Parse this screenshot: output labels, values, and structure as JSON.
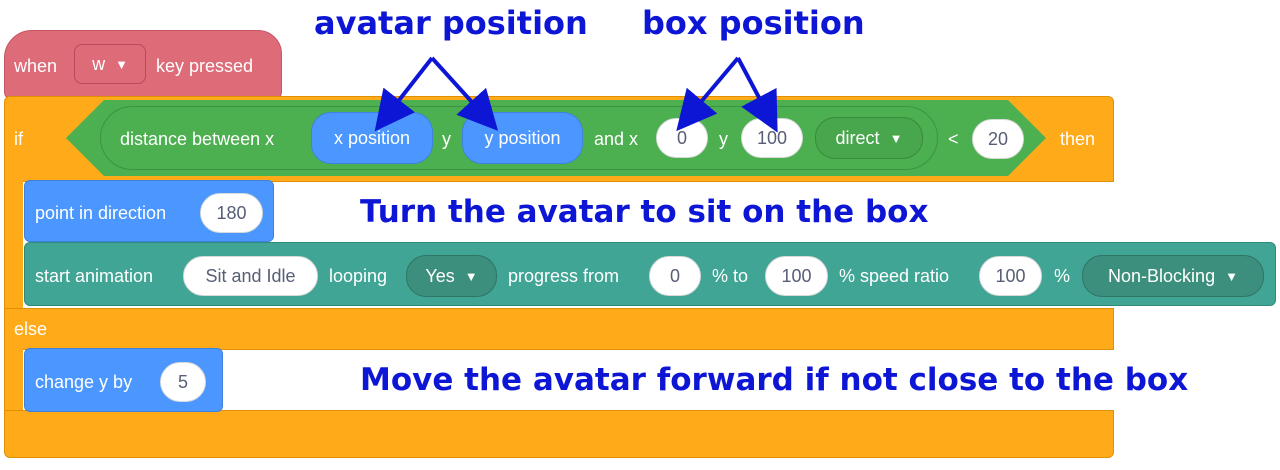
{
  "event_block": {
    "prefix": "when",
    "key_value": "w",
    "suffix": "key pressed"
  },
  "if_block": {
    "if_label": "if",
    "then_label": "then",
    "else_label": "else"
  },
  "condition": {
    "distance_label": "distance between x",
    "x_reporter": "x position",
    "y_label": "y",
    "y_reporter": "y position",
    "and_x_label": "and x",
    "x_value": "0",
    "y_label_2": "y",
    "y_value": "100",
    "mode_value": "direct",
    "operator": "<",
    "threshold_value": "20"
  },
  "point_block": {
    "label": "point in direction",
    "value": "180"
  },
  "animation_block": {
    "label": "start animation",
    "animation_value": "Sit and Idle",
    "looping_label": "looping",
    "looping_value": "Yes",
    "progress_label": "progress from",
    "progress_from": "0",
    "to_label": "% to",
    "progress_to": "100",
    "speed_label": "% speed ratio",
    "speed_value": "100",
    "percent_label": "%",
    "blocking_value": "Non-Blocking"
  },
  "change_block": {
    "label": "change y by",
    "value": "5"
  },
  "annotations": {
    "avatar_position": "avatar position",
    "box_position": "box position",
    "turn_note": "Turn the avatar to sit on the box",
    "move_note": "Move the avatar forward if not close to the box"
  },
  "colors": {
    "event": "#dd6b78",
    "control": "#ffab19",
    "operator": "#4caf50",
    "motion": "#4c97ff",
    "animation": "#40a594",
    "annotation": "#0e16d6"
  },
  "icons": {
    "dropdown": "caret-down-icon"
  }
}
